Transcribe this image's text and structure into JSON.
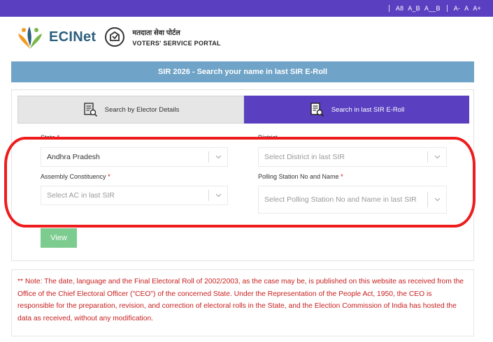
{
  "topbar": {
    "links": [
      "A8",
      "A_B",
      "A__B",
      "A-",
      "A",
      "A+"
    ]
  },
  "header": {
    "brand": "ECINet",
    "portal_hindi": "मतदाता सेवा पोर्टल",
    "portal_english": "VOTERS' SERVICE PORTAL"
  },
  "banner": {
    "title": "SIR 2026 - Search your name in last SIR E-Roll"
  },
  "tabs": [
    {
      "label": "Search by Elector Details",
      "active": false
    },
    {
      "label": "Search in last SIR E-Roll",
      "active": true
    }
  ],
  "form": {
    "state": {
      "label": "State",
      "value": "Andhra Pradesh"
    },
    "district": {
      "label": "District",
      "placeholder": "Select District in last SIR"
    },
    "ac": {
      "label": "Assembly Constituency",
      "placeholder": "Select AC in last SIR"
    },
    "polling": {
      "label": "Polling Station No and Name",
      "placeholder": "Select Polling Station No and Name in last SIR"
    },
    "required_marker": "*",
    "view_label": "View"
  },
  "note": {
    "text": "** Note: The date, language and the Final Electoral Roll of 2002/2003, as the case may be, is published on this website as received from the Office of the Chief Electoral Officer (\"CEO\") of the concerned State. Under the Representation of the People Act, 1950, the CEO is responsible for the preparation, revision, and correction of electoral rolls in the State, and the Election Commission of India has hosted the data as received, without any modification."
  },
  "colors": {
    "topbar": "#5a3fc0",
    "banner": "#6fa3c7",
    "active_tab": "#5a3fc0",
    "view_button": "#7dcc8f",
    "note_text": "#c81e1e",
    "annotation": "#ee1c1c"
  }
}
